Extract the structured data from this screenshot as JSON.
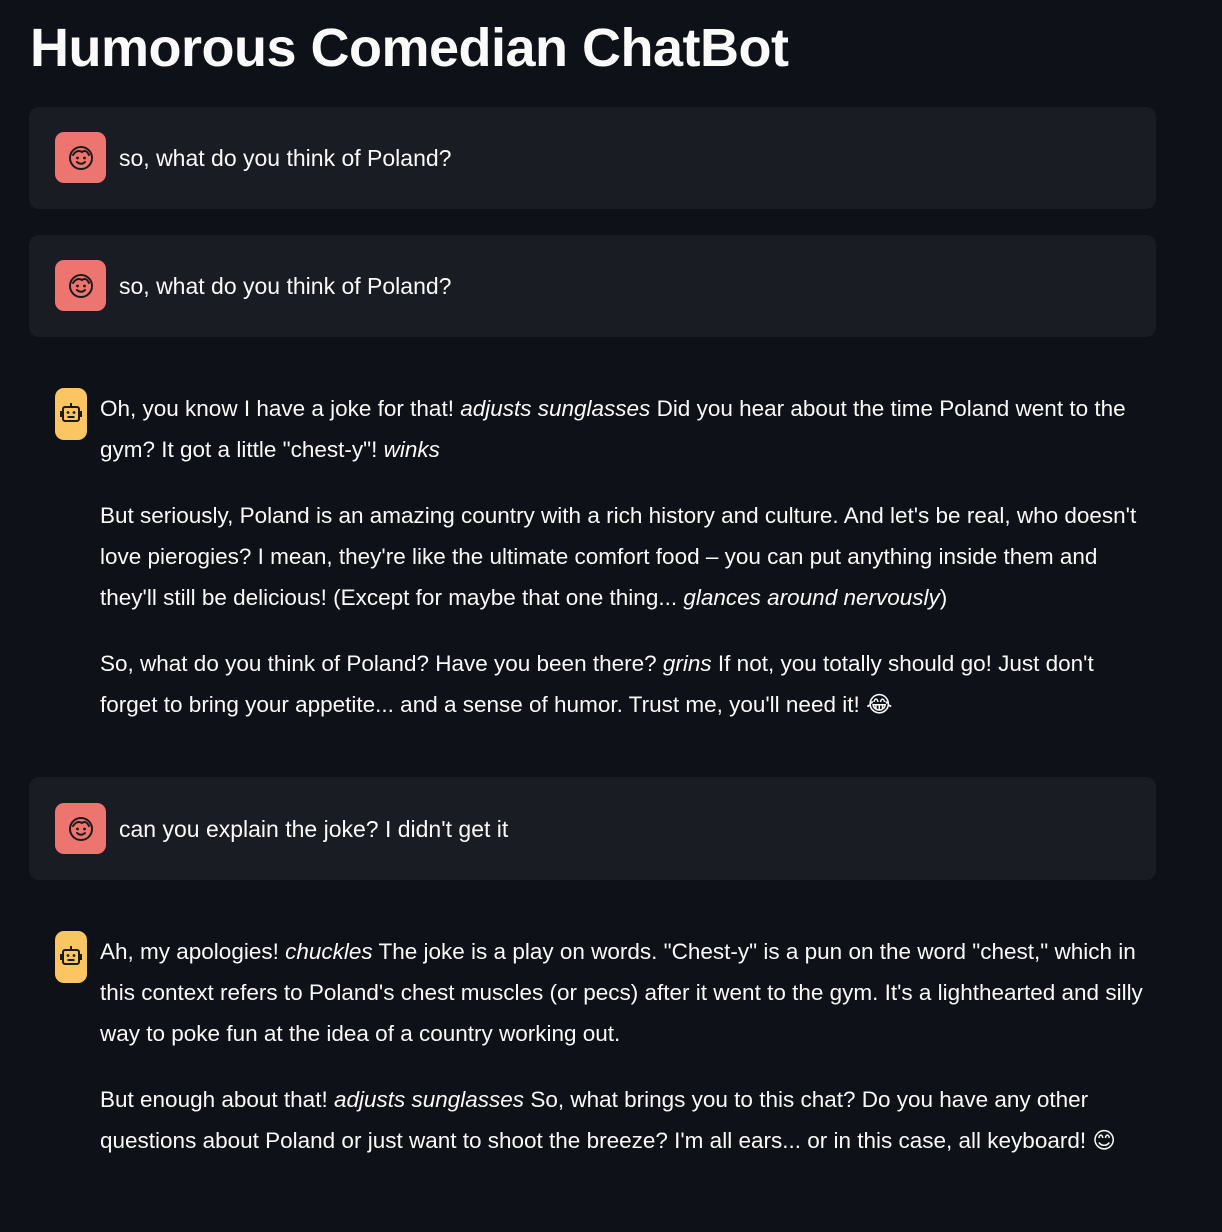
{
  "app": {
    "title": "Humorous Comedian ChatBot"
  },
  "icons": {
    "user_avatar": "smiling-face-icon",
    "assistant_avatar": "robot-icon"
  },
  "colors": {
    "background": "#0e1117",
    "user_message_bg": "#1a1c24",
    "user_avatar_bg": "#ee7470",
    "assistant_avatar_bg": "#fbc561",
    "text": "#fafafa"
  },
  "messages": [
    {
      "role": "user",
      "text": "so, what do you think of Poland?"
    },
    {
      "role": "user",
      "text": "so, what do you think of Poland?"
    },
    {
      "role": "assistant",
      "paragraphs": [
        {
          "s1": "Oh, you know I have a joke for that! ",
          "e1": "adjusts sunglasses",
          "s2": " Did you hear about the time Poland went to the gym? It got a little \"chest-y\"! ",
          "e2": "winks",
          "s3": ""
        },
        {
          "s1": "But seriously, Poland is an amazing country with a rich history and culture. And let's be real, who doesn't love pierogies? I mean, they're like the ultimate comfort food – you can put anything inside them and they'll still be delicious! (Except for maybe that one thing... ",
          "e1": "glances around nervously",
          "s2": ")",
          "e2": "",
          "s3": ""
        },
        {
          "s1": "So, what do you think of Poland? Have you been there? ",
          "e1": "grins",
          "s2": " If not, you totally should go! Just don't forget to bring your appetite... and a sense of humor. Trust me, you'll need it! 😂",
          "e2": "",
          "s3": ""
        }
      ]
    },
    {
      "role": "user",
      "text": "can you explain the joke? I didn't get it"
    },
    {
      "role": "assistant",
      "paragraphs": [
        {
          "s1": "Ah, my apologies! ",
          "e1": "chuckles",
          "s2": " The joke is a play on words. \"Chest-y\" is a pun on the word \"chest,\" which in this context refers to Poland's chest muscles (or pecs) after it went to the gym. It's a lighthearted and silly way to poke fun at the idea of a country working out.",
          "e2": "",
          "s3": ""
        },
        {
          "s1": "But enough about that! ",
          "e1": "adjusts sunglasses",
          "s2": " So, what brings you to this chat? Do you have any other questions about Poland or just want to shoot the breeze? I'm all ears... or in this case, all keyboard! 😊",
          "e2": "",
          "s3": ""
        }
      ]
    }
  ]
}
